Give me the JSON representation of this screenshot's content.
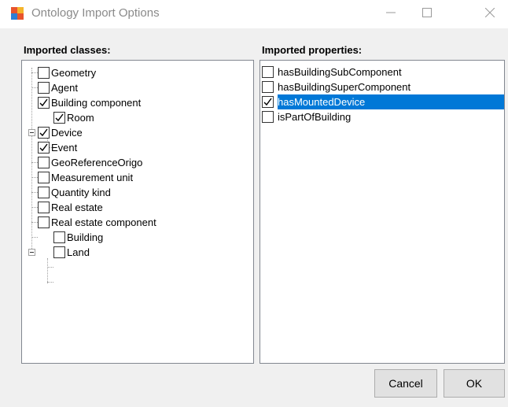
{
  "window": {
    "title": "Ontology Import Options",
    "icon": "app-window-icon"
  },
  "classes": {
    "label": "Imported classes:",
    "items": [
      {
        "label": "Geometry",
        "checked": false
      },
      {
        "label": "Agent",
        "checked": false
      },
      {
        "label": "Building component",
        "checked": true,
        "expanded": true
      },
      {
        "label": "Room",
        "checked": true
      },
      {
        "label": "Device",
        "checked": true
      },
      {
        "label": "Event",
        "checked": true
      },
      {
        "label": "GeoReferenceOrigo",
        "checked": false
      },
      {
        "label": "Measurement unit",
        "checked": false
      },
      {
        "label": "Quantity kind",
        "checked": false
      },
      {
        "label": "Real estate",
        "checked": false
      },
      {
        "label": "Real estate component",
        "checked": false,
        "expanded": true
      },
      {
        "label": "Building",
        "checked": false
      },
      {
        "label": "Land",
        "checked": false
      }
    ]
  },
  "properties": {
    "label": "Imported properties:",
    "items": [
      {
        "label": "hasBuildingSubComponent",
        "checked": false
      },
      {
        "label": "hasBuildingSuperComponent",
        "checked": false
      },
      {
        "label": "hasMountedDevice",
        "checked": true,
        "selected": true
      },
      {
        "label": "isPartOfBuilding",
        "checked": false
      }
    ]
  },
  "buttons": {
    "cancel": "Cancel",
    "ok": "OK"
  },
  "colors": {
    "selection": "#0078d7",
    "dialog_background": "#f0f0f0"
  }
}
